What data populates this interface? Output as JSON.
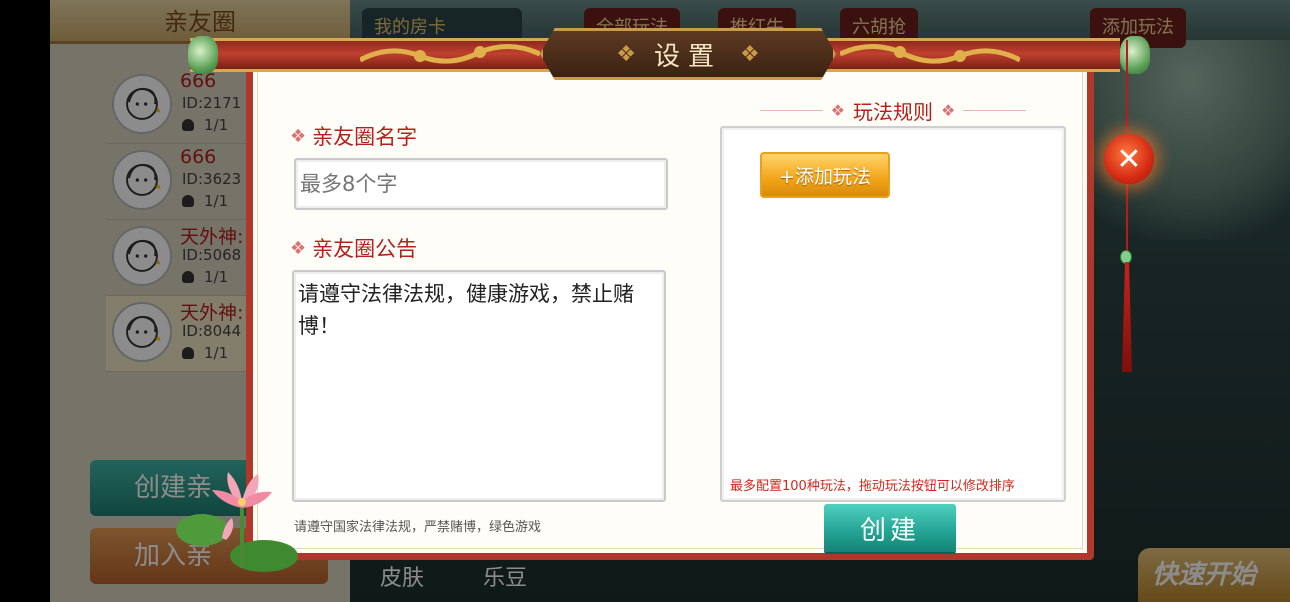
{
  "background": {
    "left_panel_title": "亲友圈",
    "room_card_label": "我的房卡",
    "top_buttons": [
      "全部玩法",
      "推红牛",
      "六胡抢",
      "添加玩法"
    ],
    "circles": [
      {
        "name": "666",
        "id": "ID:2171",
        "members": "1/1"
      },
      {
        "name": "666",
        "id": "ID:3623",
        "members": "1/1"
      },
      {
        "name": "天外神:",
        "id": "ID:5068",
        "members": "1/1"
      },
      {
        "name": "天外神:",
        "id": "ID:8044",
        "members": "1/1"
      }
    ],
    "create_circle_label": "创建亲",
    "join_circle_label": "加入亲",
    "bottom_tabs": [
      "皮肤",
      "乐豆"
    ],
    "quick_start_label": "快速开始"
  },
  "dialog": {
    "title": "设置",
    "name_label": "亲友圈名字",
    "name_placeholder": "最多8个字",
    "notice_label": "亲友圈公告",
    "notice_value": "请遵守法律法规，健康游戏，禁止赌博！",
    "left_hint": "请遵守国家法律法规，严禁赌博，绿色游戏",
    "rules_title": "玩法规则",
    "add_rule_label": "+添加玩法",
    "rules_hint": "最多配置100种玩法，拖动玩法按钮可以修改排序",
    "create_label": "创建",
    "close_symbol": "✕"
  },
  "colors": {
    "dialog_border": "#b0382a",
    "label_red": "#b3221a",
    "create_teal": "#25a696",
    "add_rule_orange": "#f2a418"
  }
}
